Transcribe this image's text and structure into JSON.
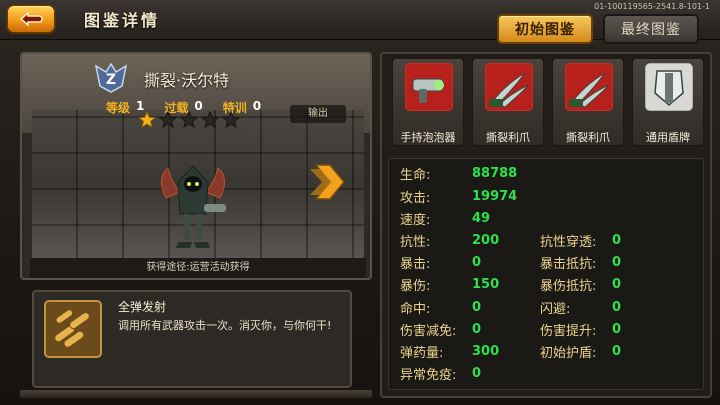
{
  "header": {
    "title": "图鉴详情",
    "version": "01-100119565-2541.8-101-1",
    "tab_initial": "初始图鉴",
    "tab_final": "最终图鉴"
  },
  "hero": {
    "name": "撕裂·沃尔特",
    "rank_letter": "Z",
    "level_label": "等级",
    "level": "1",
    "overload_label": "过载",
    "overload": "0",
    "training_label": "特训",
    "training": "0",
    "stars_filled": 1,
    "stars_total": 5,
    "role_tag": "输出",
    "acquire": "获得途径:运营活动获得"
  },
  "skill": {
    "name": "全弹发射",
    "description": "调用所有武器攻击一次。消灭你，与你何干!"
  },
  "equipment": [
    {
      "label": "手持泡泡器",
      "icon": "bubble-gun-icon"
    },
    {
      "label": "撕裂利爪",
      "icon": "claw-icon"
    },
    {
      "label": "撕裂利爪",
      "icon": "claw-icon"
    },
    {
      "label": "通用盾牌",
      "icon": "shield-icon"
    }
  ],
  "attributes": {
    "hp": {
      "label": "生命:",
      "value": "88788"
    },
    "atk": {
      "label": "攻击:",
      "value": "19974"
    },
    "spd": {
      "label": "速度:",
      "value": "49"
    },
    "res": {
      "label": "抗性:",
      "value": "200"
    },
    "res_pen": {
      "label": "抗性穿透:",
      "value": "0"
    },
    "crit": {
      "label": "暴击:",
      "value": "0"
    },
    "crit_res": {
      "label": "暴击抵抗:",
      "value": "0"
    },
    "crit_dmg": {
      "label": "暴伤:",
      "value": "150"
    },
    "crit_dmg_res": {
      "label": "暴伤抵抗:",
      "value": "0"
    },
    "hit": {
      "label": "命中:",
      "value": "0"
    },
    "dodge": {
      "label": "闪避:",
      "value": "0"
    },
    "dmg_red": {
      "label": "伤害减免:",
      "value": "0"
    },
    "dmg_up": {
      "label": "伤害提升:",
      "value": "0"
    },
    "ammo": {
      "label": "弹药量:",
      "value": "300"
    },
    "init_shield": {
      "label": "初始护盾:",
      "value": "0"
    },
    "immunity": {
      "label": "异常免疫:",
      "value": "0"
    }
  },
  "colors": {
    "accent_gold": "#f2b21f",
    "value_green": "#2ee04a",
    "label_gold": "#ead38f"
  }
}
